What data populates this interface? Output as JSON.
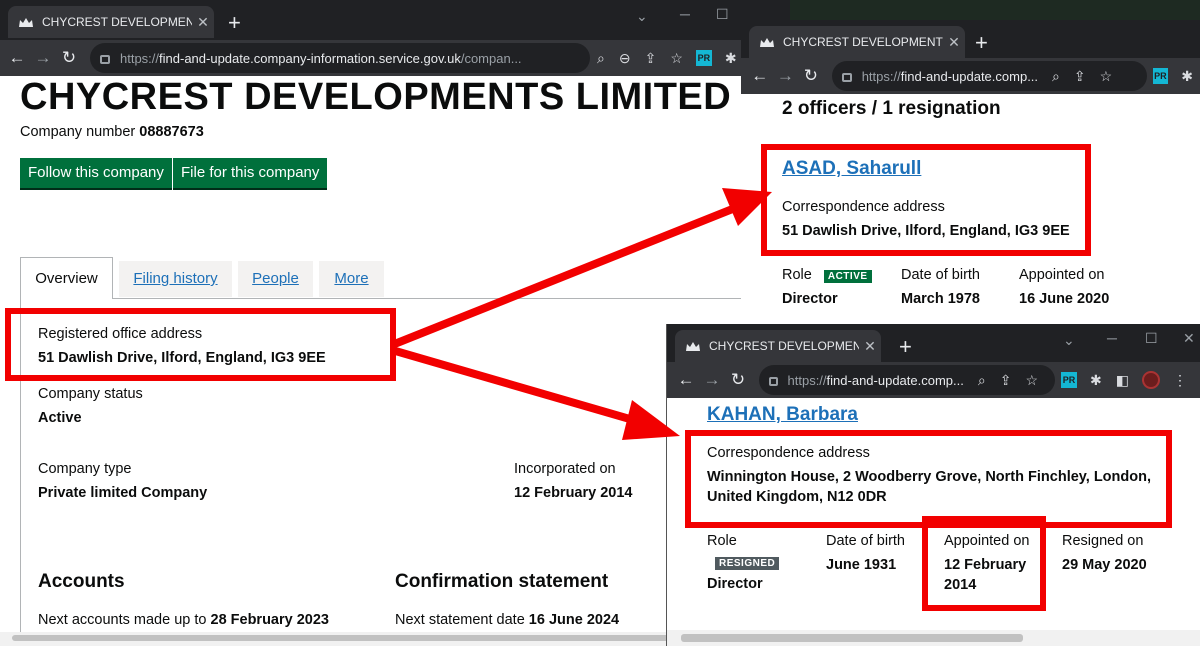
{
  "main": {
    "tab_title": "CHYCREST DEVELOPMENTS LIMI",
    "url_scheme": "https://",
    "url_host": "find-and-update.company-information.service.gov.uk",
    "url_path": "/compan...",
    "company_name": "CHYCREST DEVELOPMENTS LIMITED",
    "company_number_label": "Company number",
    "company_number": "08887673",
    "follow_button": "Follow this company",
    "file_button": "File for this company",
    "tabs": [
      "Overview",
      "Filing history",
      "People",
      "More"
    ],
    "registered_office_label": "Registered office address",
    "registered_office_value": "51 Dawlish Drive, Ilford, England, IG3 9EE",
    "status_label": "Company status",
    "status_value": "Active",
    "type_label": "Company type",
    "type_value": "Private limited Company",
    "incorporated_label": "Incorporated on",
    "incorporated_value": "12 February 2014",
    "accounts_heading": "Accounts",
    "accounts_text": "Next accounts made up to",
    "accounts_date": "28 February 2023",
    "confirmation_heading": "Confirmation statement",
    "confirmation_text": "Next statement date",
    "confirmation_date": "16 June 2024"
  },
  "officer1": {
    "tab_title": "CHYCREST DEVELOPMENTS LIMI",
    "url_scheme": "https://",
    "url_host": "find-and-update.comp...",
    "heading": "2 officers / 1 resignation",
    "name": "ASAD, Saharull",
    "address_label": "Correspondence address",
    "address_value": "51 Dawlish Drive, Ilford, England, IG3 9EE",
    "role_label": "Role",
    "role_badge": "ACTIVE",
    "role_value": "Director",
    "dob_label": "Date of birth",
    "dob_value": "March 1978",
    "appointed_label": "Appointed on",
    "appointed_value": "16 June 2020"
  },
  "officer2": {
    "tab_title": "CHYCREST DEVELOPMENTS LIMI",
    "url_scheme": "https://",
    "url_host": "find-and-update.comp...",
    "name": "KAHAN, Barbara",
    "address_label": "Correspondence address",
    "address_line1": "Winnington House, 2 Woodberry Grove, North Finchley, London,",
    "address_line2": "United Kingdom, N12 0DR",
    "role_label": "Role",
    "role_badge": "RESIGNED",
    "role_value": "Director",
    "dob_label": "Date of birth",
    "dob_value": "June 1931",
    "appointed_label": "Appointed on",
    "appointed_value_line1": "12 February",
    "appointed_value_line2": "2014",
    "resigned_label": "Resigned on",
    "resigned_value": "29 May 2020"
  },
  "ext_label": "PR",
  "colors": {
    "annotation": "#f20000",
    "gov_green": "#00703c",
    "link": "#1d70b8",
    "active_badge": "#00703c",
    "resigned_badge": "#505a5f"
  }
}
